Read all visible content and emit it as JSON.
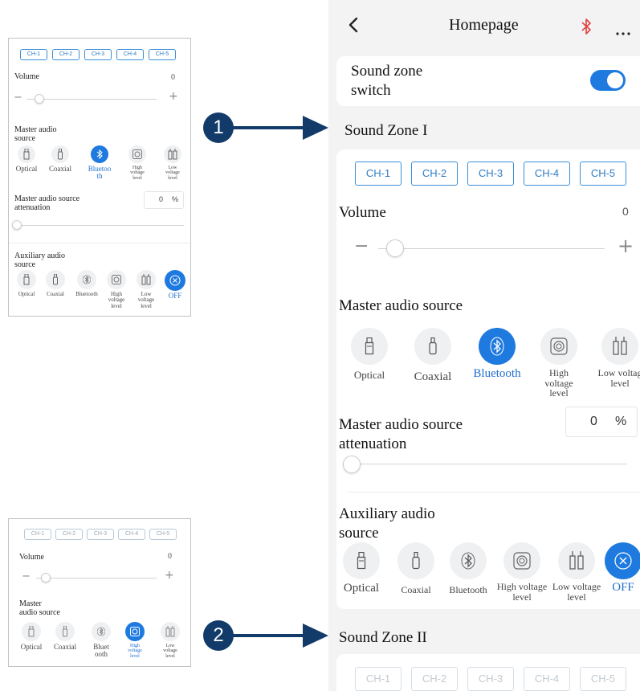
{
  "channels": [
    "CH-1",
    "CH-2",
    "CH-3",
    "CH-4",
    "CH-5"
  ],
  "colors": {
    "accent": "#1f7ae0",
    "arrow": "#123b6a",
    "bluetooth_red": "#e0413e"
  },
  "small_top": {
    "volume_label": "Volume",
    "volume_value": "0",
    "master_label_1": "Master audio",
    "master_label_2": "source",
    "sources": [
      "Optical",
      "Coaxial",
      "Bluetoo",
      "High",
      "Low"
    ],
    "sources_line2": [
      "",
      "",
      "th",
      "voltage",
      "voltage"
    ],
    "sources_line3": [
      "",
      "",
      "",
      "level",
      "level"
    ],
    "attenuation_label_1": "Master audio source",
    "attenuation_label_2": "attenuation",
    "attenuation_value": "0",
    "percent": "%",
    "aux_label_1": "Auxiliary audio",
    "aux_label_2": "source",
    "aux_sources": [
      "Optical",
      "Coaxial",
      "Bluetooth",
      "High",
      "Low",
      "OFF"
    ],
    "aux_line2": [
      "",
      "",
      "",
      "voltage",
      "voltage",
      ""
    ],
    "aux_line3": [
      "",
      "",
      "",
      "level",
      "level",
      ""
    ]
  },
  "small_bottom": {
    "volume_label": "Volume",
    "volume_value": "0",
    "master_label_1": "Master",
    "master_label_2": "audio source",
    "sources": [
      "Optical",
      "Coaxial",
      "Bluet",
      "High",
      "Low"
    ],
    "sources_line2": [
      "",
      "",
      "ooth",
      "voltage",
      "voltage"
    ],
    "sources_line3": [
      "",
      "",
      "",
      "level",
      "level"
    ]
  },
  "badges": {
    "one": "1",
    "two": "2"
  },
  "phone": {
    "title": "Homepage",
    "sound_zone_switch_1": "Sound zone",
    "sound_zone_switch_2": "switch",
    "sound_zone_switch_on": true,
    "zone1_title": "Sound Zone I",
    "volume_label": "Volume",
    "volume_value": "0",
    "master_label": "Master audio source",
    "sources": [
      "Optical",
      "Coaxial",
      "Bluetooth",
      "High",
      "Low voltag"
    ],
    "sources_line2": [
      "",
      "",
      "",
      "voltage",
      "level"
    ],
    "sources_line3": [
      "",
      "",
      "",
      "level",
      ""
    ],
    "attenuation_label_1": "Master audio source",
    "attenuation_label_2": "attenuation",
    "attenuation_value": "0",
    "percent": "%",
    "aux_label_1": "Auxiliary audio",
    "aux_label_2": "source",
    "aux_sources": [
      "Optical",
      "Coaxial",
      "Bluetooth",
      "High voltage",
      "Low voltage",
      "OFF"
    ],
    "aux_line2": [
      "",
      "",
      "",
      "level",
      "level",
      ""
    ],
    "zone2_title": "Sound Zone II"
  }
}
